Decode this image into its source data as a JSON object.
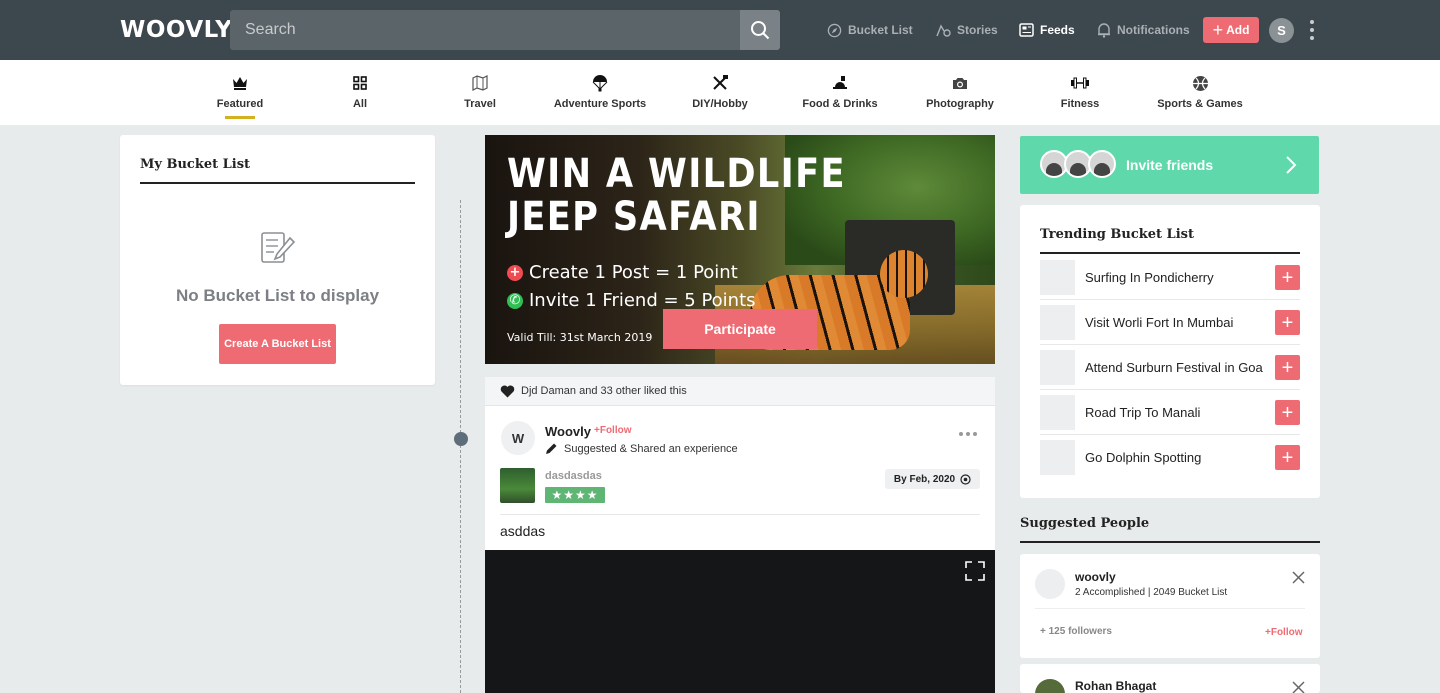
{
  "header": {
    "logo": "WOOVLY",
    "search_placeholder": "Search",
    "nav": [
      {
        "label": "Bucket List",
        "icon": "compass-icon",
        "active": false
      },
      {
        "label": "Stories",
        "icon": "stories-icon",
        "active": false
      },
      {
        "label": "Feeds",
        "icon": "feeds-icon",
        "active": true
      },
      {
        "label": "Notifications",
        "icon": "bell-icon",
        "active": false
      }
    ],
    "add_label": "Add",
    "avatar_initial": "S"
  },
  "categories": [
    {
      "label": "Featured",
      "icon": "crown-icon",
      "active": true
    },
    {
      "label": "All",
      "icon": "grid-icon"
    },
    {
      "label": "Travel",
      "icon": "map-icon"
    },
    {
      "label": "Adventure Sports",
      "icon": "parachute-icon"
    },
    {
      "label": "DIY/Hobby",
      "icon": "tools-icon"
    },
    {
      "label": "Food & Drinks",
      "icon": "food-icon"
    },
    {
      "label": "Photography",
      "icon": "camera-icon"
    },
    {
      "label": "Fitness",
      "icon": "dumbbell-icon"
    },
    {
      "label": "Sports & Games",
      "icon": "ball-icon"
    }
  ],
  "my_bucket": {
    "title": "My Bucket List",
    "empty_text": "No Bucket List to display",
    "create_label": "Create A Bucket List"
  },
  "banner": {
    "line1": "WIN A WILDLIFE",
    "line2": "JEEP SAFARI",
    "point1": "Create 1 Post = 1 Point",
    "point2": "Invite 1 Friend = 5 Points",
    "valid": "Valid Till: 31st March 2019",
    "cta": "Participate"
  },
  "post": {
    "liked_text": "Djd Daman and 33 other liked this",
    "avatar_initial": "W",
    "author": "Woovly",
    "follow": "+Follow",
    "action": "Suggested & Shared an experience",
    "experience": "dasdasdas",
    "stars": "★★★★",
    "date": "By Feb, 2020",
    "body": "asddas"
  },
  "invite": {
    "label": "Invite friends"
  },
  "trending": {
    "title": "Trending Bucket List",
    "items": [
      "Surfing In Pondicherry",
      "Visit Worli Fort In Mumbai",
      "Attend Surburn Festival in Goa",
      "Road Trip To Manali",
      "Go Dolphin Spotting"
    ]
  },
  "suggested": {
    "title": "Suggested People",
    "people": [
      {
        "name": "woovly",
        "meta": "2 Accomplished | 2049 Bucket List",
        "followers": "+ 125 followers",
        "follow": "+Follow"
      },
      {
        "name": "Rohan Bhagat"
      }
    ]
  },
  "colors": {
    "accent": "#ef6b73",
    "header": "#3d474e",
    "invite": "#5fd8ab",
    "gold": "#d3b21f"
  }
}
